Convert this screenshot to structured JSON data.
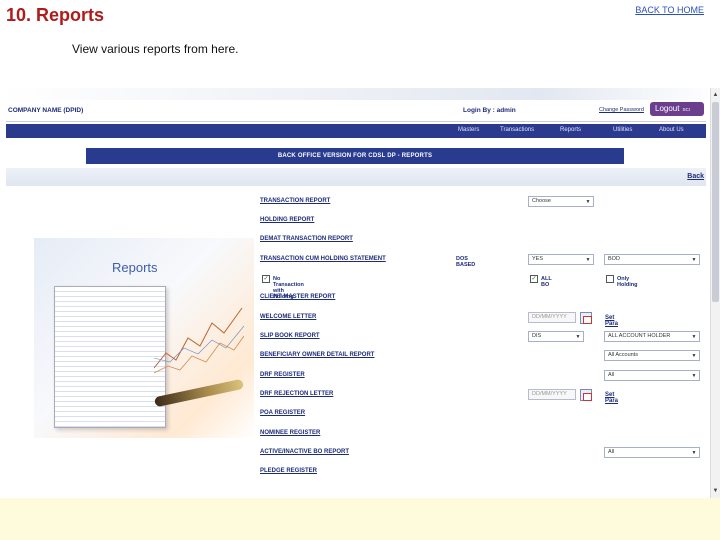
{
  "slide": {
    "title": "10. Reports",
    "back_home": "BACK TO HOME",
    "subtitle": "View various reports from here."
  },
  "app": {
    "company": "COMPANY NAME (DPID)",
    "login": "Login By : admin",
    "change_password": "Change Password",
    "logout": "Logout",
    "logout_suffix": "SCI",
    "menu": [
      "Masters",
      "Transactions",
      "Reports",
      "Utilities",
      "About Us"
    ],
    "banner": "BACK OFFICE VERSION FOR CDSL DP - REPORTS",
    "back": "Back",
    "hero_label": "Reports"
  },
  "reports": [
    {
      "label": "TRANSACTION REPORT",
      "select": "Choose"
    },
    {
      "label": "HOLDING REPORT"
    },
    {
      "label": "DEMAT TRANSACTION REPORT"
    },
    {
      "label": "TRANSACTION CUM HOLDING STATEMENT",
      "dos": "DOS BASED",
      "select": "YES",
      "select2": "BOD"
    },
    {
      "label": "",
      "check": "No Transaction with Holding",
      "check2": "ALL BO",
      "check3": "Only Holding"
    },
    {
      "label": "CLIENT MASTER REPORT"
    },
    {
      "label": "WELCOME LETTER",
      "date": "DD/MM/YYYY",
      "set_para": "Set Para"
    },
    {
      "label": "SLIP BOOK REPORT",
      "select": "DIS",
      "select2": "ALL ACCOUNT HOLDER"
    },
    {
      "label": "BENEFICIARY OWNER DETAIL REPORT",
      "select2": "All Accounts"
    },
    {
      "label": "DRF REGISTER",
      "select2": "All"
    },
    {
      "label": "DRF REJECTION LETTER",
      "date": "DD/MM/YYYY",
      "set_para": "Set Para"
    },
    {
      "label": "POA REGISTER"
    },
    {
      "label": "NOMINEE REGISTER"
    },
    {
      "label": "ACTIVE/INACTIVE BO REPORT",
      "select2": "All"
    },
    {
      "label": "PLEDGE REGISTER"
    }
  ],
  "colors": {
    "title": "#b11a1a",
    "nav": "#2c3a8e",
    "link": "#1d2c78",
    "logout": "#6b3f8e"
  }
}
